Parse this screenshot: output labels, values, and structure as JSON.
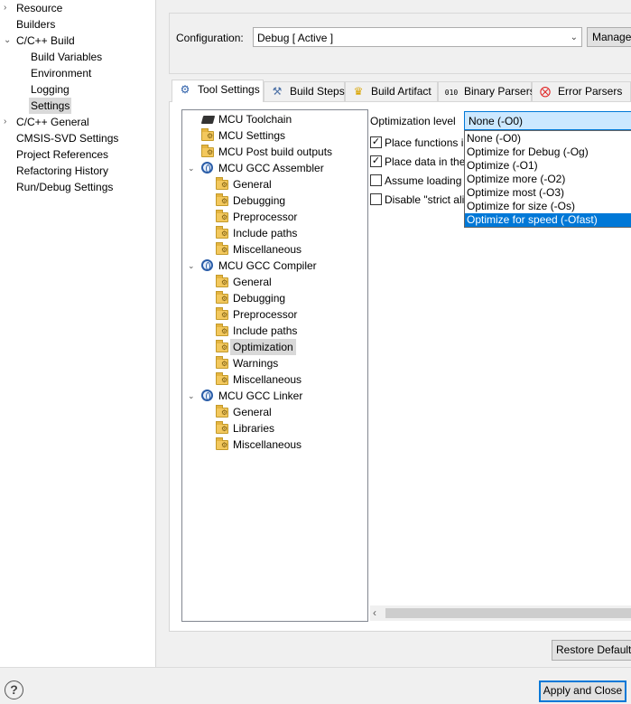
{
  "left_nav": {
    "items": [
      {
        "label": "Resource",
        "chevron": "›"
      },
      {
        "label": "Builders",
        "chevron": ""
      },
      {
        "label": "C/C++ Build",
        "chevron": "⌄"
      },
      {
        "label": "Build Variables",
        "chevron": ""
      },
      {
        "label": "Environment",
        "chevron": ""
      },
      {
        "label": "Logging",
        "chevron": ""
      },
      {
        "label": "Settings",
        "chevron": ""
      },
      {
        "label": "C/C++ General",
        "chevron": "›"
      },
      {
        "label": "CMSIS-SVD Settings",
        "chevron": ""
      },
      {
        "label": "Project References",
        "chevron": ""
      },
      {
        "label": "Refactoring History",
        "chevron": ""
      },
      {
        "label": "Run/Debug Settings",
        "chevron": ""
      }
    ]
  },
  "configuration": {
    "label": "Configuration:",
    "value": "Debug  [ Active ]",
    "manage_label": "Manage"
  },
  "tabs": [
    {
      "label": "Tool Settings",
      "icon": "tool-settings-icon"
    },
    {
      "label": "Build Steps",
      "icon": "build-steps-icon"
    },
    {
      "label": "Build Artifact",
      "icon": "build-artifact-icon"
    },
    {
      "label": "Binary Parsers",
      "icon": "binary-parsers-icon"
    },
    {
      "label": "Error Parsers",
      "icon": "error-parsers-icon"
    }
  ],
  "tree": {
    "items": [
      {
        "label": "MCU Toolchain",
        "icon": "chip-icon",
        "expander": ""
      },
      {
        "label": "MCU Settings",
        "icon": "folder-icon",
        "expander": ""
      },
      {
        "label": "MCU Post build outputs",
        "icon": "folder-icon",
        "expander": ""
      },
      {
        "label": "MCU GCC Assembler",
        "icon": "tool-icon",
        "expander": "⌄"
      },
      {
        "label": "General",
        "icon": "folder-icon",
        "expander": ""
      },
      {
        "label": "Debugging",
        "icon": "folder-icon",
        "expander": ""
      },
      {
        "label": "Preprocessor",
        "icon": "folder-icon",
        "expander": ""
      },
      {
        "label": "Include paths",
        "icon": "folder-icon",
        "expander": ""
      },
      {
        "label": "Miscellaneous",
        "icon": "folder-icon",
        "expander": ""
      },
      {
        "label": "MCU GCC Compiler",
        "icon": "tool-icon",
        "expander": "⌄"
      },
      {
        "label": "General",
        "icon": "folder-icon",
        "expander": ""
      },
      {
        "label": "Debugging",
        "icon": "folder-icon",
        "expander": ""
      },
      {
        "label": "Preprocessor",
        "icon": "folder-icon",
        "expander": ""
      },
      {
        "label": "Include paths",
        "icon": "folder-icon",
        "expander": ""
      },
      {
        "label": "Optimization",
        "icon": "folder-icon",
        "expander": ""
      },
      {
        "label": "Warnings",
        "icon": "folder-icon",
        "expander": ""
      },
      {
        "label": "Miscellaneous",
        "icon": "folder-icon",
        "expander": ""
      },
      {
        "label": "MCU GCC Linker",
        "icon": "tool-icon",
        "expander": "⌄"
      },
      {
        "label": "General",
        "icon": "folder-icon",
        "expander": ""
      },
      {
        "label": "Libraries",
        "icon": "folder-icon",
        "expander": ""
      },
      {
        "label": "Miscellaneous",
        "icon": "folder-icon",
        "expander": ""
      }
    ]
  },
  "optimization": {
    "label": "Optimization level",
    "selected": "None (-O0)",
    "options": [
      "None (-O0)",
      "Optimize for Debug (-Og)",
      "Optimize (-O1)",
      "Optimize more (-O2)",
      "Optimize most (-O3)",
      "Optimize for size (-Os)",
      "Optimize for speed (-Ofast)"
    ],
    "highlighted_index": 6,
    "checkboxes": [
      {
        "label": "Place functions i",
        "checked": true,
        "mark": "✓"
      },
      {
        "label": "Place data in the",
        "checked": true,
        "mark": "✓"
      },
      {
        "label": "Assume loading",
        "checked": false,
        "mark": ""
      },
      {
        "label": "Disable \"strict ali",
        "checked": false,
        "mark": ""
      }
    ]
  },
  "scrollbar": {
    "arrow": "‹"
  },
  "buttons": {
    "restore_defaults": "Restore Defaults",
    "apply_and_close": "Apply and Close",
    "help": "?"
  },
  "colors": {
    "selection_blue": "#0078d7",
    "tree_selected": "#d9d9d9"
  }
}
